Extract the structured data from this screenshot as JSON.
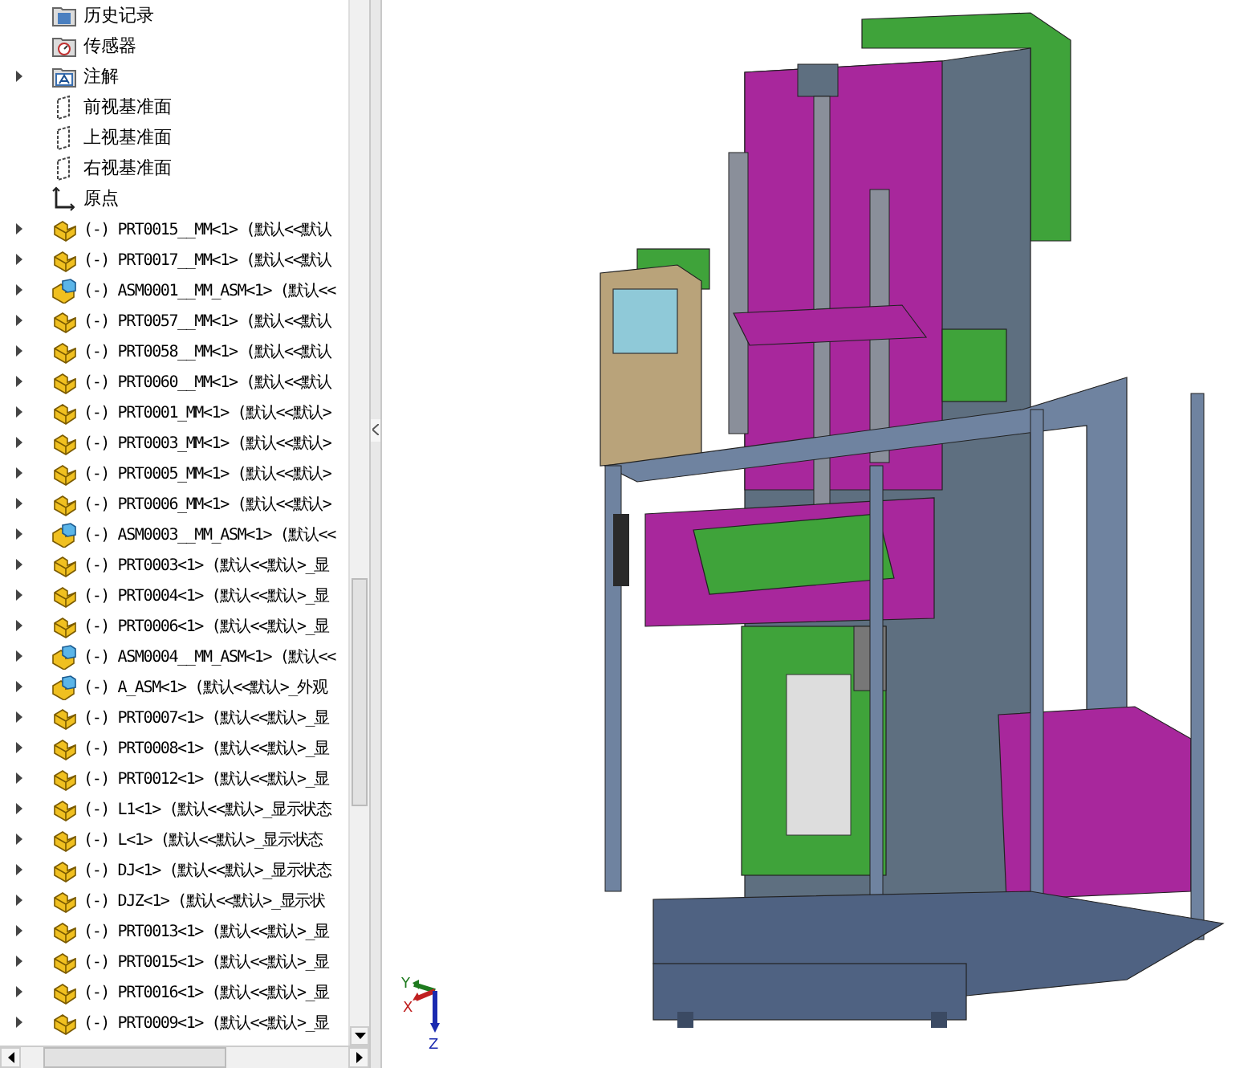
{
  "feature_tree": {
    "items": [
      {
        "kind": "history",
        "label": "历史记录",
        "expandable": false
      },
      {
        "kind": "sensor",
        "label": "传感器",
        "expandable": false
      },
      {
        "kind": "annotation",
        "label": "注解",
        "expandable": true
      },
      {
        "kind": "plane",
        "label": "前视基准面",
        "expandable": false
      },
      {
        "kind": "plane",
        "label": "上视基准面",
        "expandable": false
      },
      {
        "kind": "plane",
        "label": "右视基准面",
        "expandable": false
      },
      {
        "kind": "origin",
        "label": "原点",
        "expandable": false
      },
      {
        "kind": "part",
        "label": "(-) PRT0015__MM<1> (默认<<默认",
        "expandable": true
      },
      {
        "kind": "part",
        "label": "(-) PRT0017__MM<1> (默认<<默认",
        "expandable": true
      },
      {
        "kind": "assembly",
        "label": "(-) ASM0001__MM_ASM<1> (默认<<",
        "expandable": true
      },
      {
        "kind": "part",
        "label": "(-) PRT0057__MM<1> (默认<<默认",
        "expandable": true
      },
      {
        "kind": "part",
        "label": "(-) PRT0058__MM<1> (默认<<默认",
        "expandable": true
      },
      {
        "kind": "part",
        "label": "(-) PRT0060__MM<1> (默认<<默认",
        "expandable": true
      },
      {
        "kind": "part",
        "label": "(-) PRT0001_MM<1> (默认<<默认>",
        "expandable": true
      },
      {
        "kind": "part",
        "label": "(-) PRT0003_MM<1> (默认<<默认>",
        "expandable": true
      },
      {
        "kind": "part",
        "label": "(-) PRT0005_MM<1> (默认<<默认>",
        "expandable": true
      },
      {
        "kind": "part",
        "label": "(-) PRT0006_MM<1> (默认<<默认>",
        "expandable": true
      },
      {
        "kind": "assembly",
        "label": "(-) ASM0003__MM_ASM<1> (默认<<",
        "expandable": true
      },
      {
        "kind": "part",
        "label": "(-) PRT0003<1> (默认<<默认>_显",
        "expandable": true
      },
      {
        "kind": "part",
        "label": "(-) PRT0004<1> (默认<<默认>_显",
        "expandable": true
      },
      {
        "kind": "part",
        "label": "(-) PRT0006<1> (默认<<默认>_显",
        "expandable": true
      },
      {
        "kind": "assembly",
        "label": "(-) ASM0004__MM_ASM<1> (默认<<",
        "expandable": true
      },
      {
        "kind": "assembly",
        "label": "(-) A_ASM<1> (默认<<默认>_外观",
        "expandable": true
      },
      {
        "kind": "part",
        "label": "(-) PRT0007<1> (默认<<默认>_显",
        "expandable": true
      },
      {
        "kind": "part",
        "label": "(-) PRT0008<1> (默认<<默认>_显",
        "expandable": true
      },
      {
        "kind": "part",
        "label": "(-) PRT0012<1> (默认<<默认>_显",
        "expandable": true
      },
      {
        "kind": "part",
        "label": "(-) L1<1> (默认<<默认>_显示状态",
        "expandable": true
      },
      {
        "kind": "part",
        "label": "(-) L<1> (默认<<默认>_显示状态",
        "expandable": true
      },
      {
        "kind": "part",
        "label": "(-) DJ<1> (默认<<默认>_显示状态",
        "expandable": true
      },
      {
        "kind": "part",
        "label": "(-) DJZ<1> (默认<<默认>_显示状",
        "expandable": true
      },
      {
        "kind": "part",
        "label": "(-) PRT0013<1> (默认<<默认>_显",
        "expandable": true
      },
      {
        "kind": "part",
        "label": "(-) PRT0015<1> (默认<<默认>_显",
        "expandable": true
      },
      {
        "kind": "part",
        "label": "(-) PRT0016<1> (默认<<默认>_显",
        "expandable": true
      },
      {
        "kind": "part",
        "label": "(-) PRT0009<1> (默认<<默认>_显",
        "expandable": true
      }
    ]
  },
  "viewport": {
    "triad": {
      "y_label": "Y",
      "x_label": "X",
      "z_label": "Z"
    }
  }
}
